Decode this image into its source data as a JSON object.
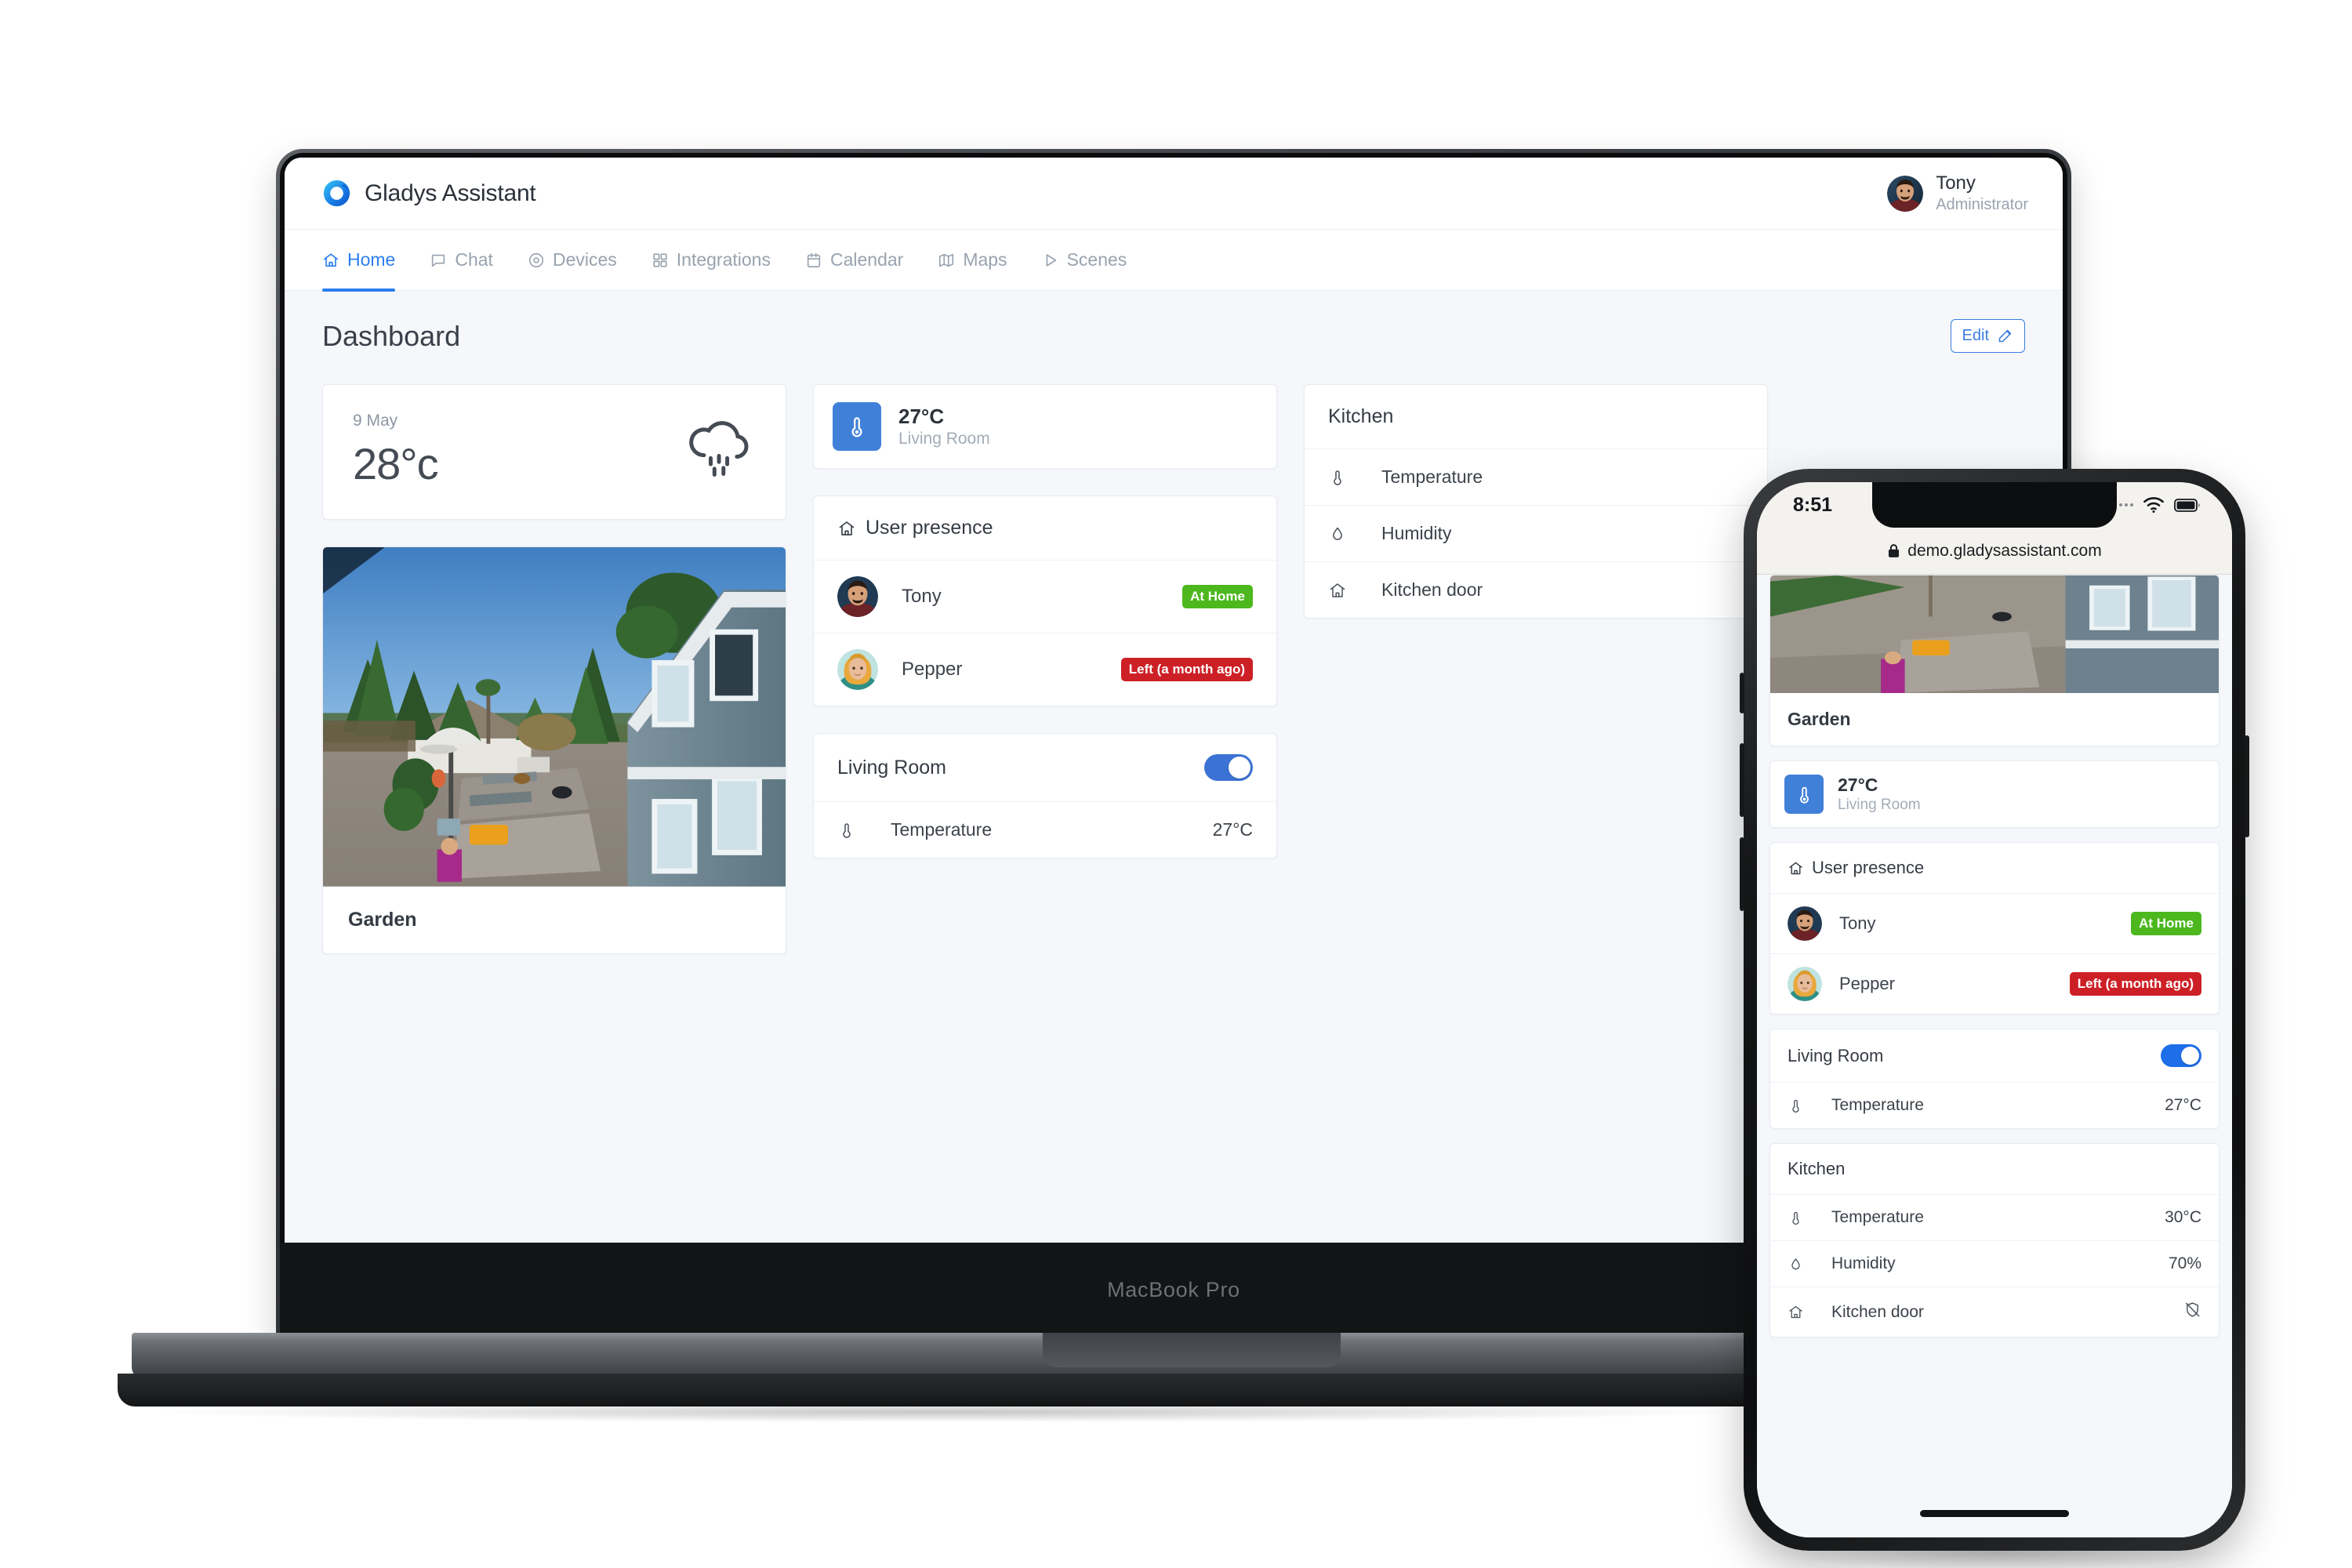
{
  "app": {
    "brand_name": "Gladys Assistant",
    "user": {
      "name": "Tony",
      "role": "Administrator"
    },
    "nav": [
      {
        "label": "Home",
        "icon": "home-icon",
        "active": true
      },
      {
        "label": "Chat",
        "icon": "chat-icon",
        "active": false
      },
      {
        "label": "Devices",
        "icon": "devices-icon",
        "active": false
      },
      {
        "label": "Integrations",
        "icon": "integrations-icon",
        "active": false
      },
      {
        "label": "Calendar",
        "icon": "calendar-icon",
        "active": false
      },
      {
        "label": "Maps",
        "icon": "maps-icon",
        "active": false
      },
      {
        "label": "Scenes",
        "icon": "scenes-icon",
        "active": false
      }
    ],
    "page_title": "Dashboard",
    "edit_label": "Edit"
  },
  "weather": {
    "date": "9 May",
    "temperature": "28°c",
    "icon": "rain-cloud-icon"
  },
  "camera": {
    "name": "Garden"
  },
  "device_summary": {
    "value": "27°C",
    "room": "Living Room",
    "icon": "thermometer-icon"
  },
  "user_presence": {
    "title": "User presence",
    "icon": "home-icon",
    "users": [
      {
        "name": "Tony",
        "status": "At Home",
        "status_color": "#4cb81e"
      },
      {
        "name": "Pepper",
        "status": "Left (a month ago)",
        "status_color": "#cd2026"
      }
    ]
  },
  "living_room": {
    "title": "Living Room",
    "toggle_on": true,
    "toggle_color": "#3b72d4",
    "rows": [
      {
        "icon": "thermometer-icon",
        "label": "Temperature",
        "value": "27°C"
      }
    ]
  },
  "kitchen": {
    "title": "Kitchen",
    "rows": [
      {
        "icon": "thermometer-icon",
        "label": "Temperature",
        "value": "30°C"
      },
      {
        "icon": "humidity-icon",
        "label": "Humidity",
        "value": "70%"
      },
      {
        "icon": "home-icon",
        "label": "Kitchen door",
        "value": "",
        "value_icon": "shield-off-icon"
      }
    ]
  },
  "laptop": {
    "model_label": "MacBook Pro"
  },
  "phone": {
    "status_time": "8:51",
    "url": "demo.gladysassistant.com",
    "lock_icon": "lock-icon",
    "wifi_icon": "wifi-icon",
    "battery_icon": "battery-icon",
    "signal_icon": "signal-dots-icon"
  }
}
